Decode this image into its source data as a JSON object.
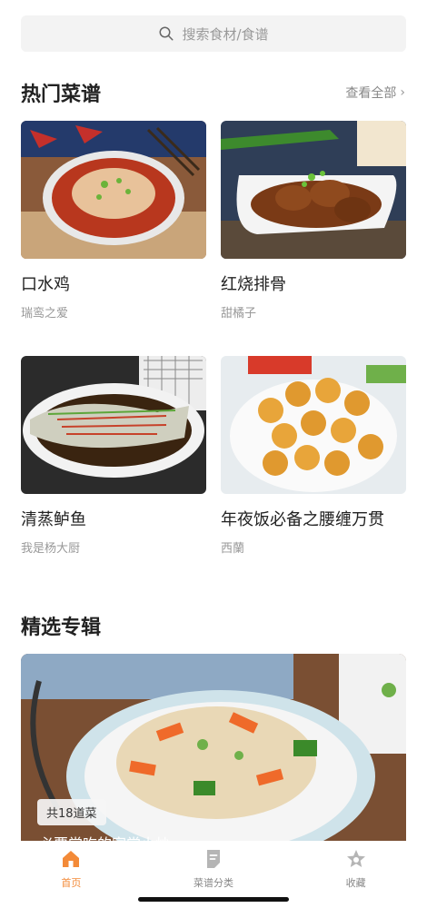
{
  "search": {
    "placeholder": "搜索食材/食谱"
  },
  "hot_section": {
    "title": "热门菜谱",
    "see_all": "查看全部"
  },
  "recipes": [
    {
      "title": "口水鸡",
      "author": "瑞鸾之爱"
    },
    {
      "title": "红烧排骨",
      "author": "甜橘子"
    },
    {
      "title": "清蒸鲈鱼",
      "author": "我是杨大厨"
    },
    {
      "title": "年夜饭必备之腰缠万贯",
      "author": "西蘭"
    }
  ],
  "featured_section": {
    "title": "精选专辑",
    "badge": "共18道菜",
    "caption": "必要常吃的家常小炒"
  },
  "tabbar": {
    "tabs": [
      {
        "label": "首页",
        "icon": "home-icon",
        "active": true
      },
      {
        "label": "菜谱分类",
        "icon": "bookmark-icon",
        "active": false
      },
      {
        "label": "收藏",
        "icon": "star-icon",
        "active": false
      }
    ]
  },
  "colors": {
    "accent": "#f38a38",
    "inactive": "#b5b5b5"
  }
}
